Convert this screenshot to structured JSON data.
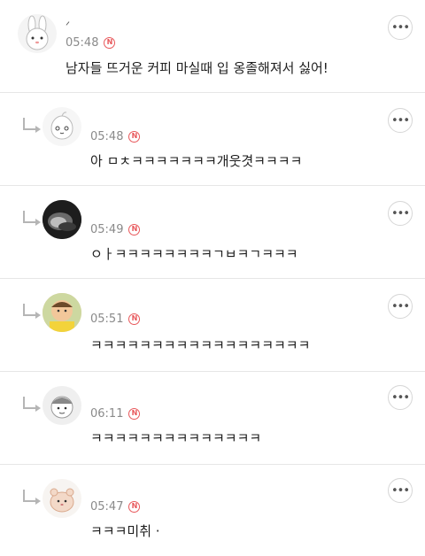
{
  "comments": [
    {
      "username": "ᐟ",
      "time": "05:48",
      "new_badge": "N",
      "text": "남자들 뜨거운 커피 마실때 입 옹졸해져서 싫어!",
      "avatar_icon": "rabbit-avatar-icon",
      "is_reply": false
    },
    {
      "time": "05:48",
      "new_badge": "N",
      "text": "아 ㅁㅊㅋㅋㅋㅋㅋㅋㅋ개웃겻ㅋㅋㅋㅋ",
      "avatar_icon": "peach-character-avatar-icon",
      "is_reply": true
    },
    {
      "time": "05:49",
      "new_badge": "N",
      "text": "ㅇㅏㅋㅋㅋㅋㅋㅋㅋㅋㄱㅂㅋㄱㅋㅋㅋ",
      "avatar_icon": "dark-photo-avatar-icon",
      "is_reply": true
    },
    {
      "time": "05:51",
      "new_badge": "N",
      "text": "ㅋㅋㅋㅋㅋㅋㅋㅋㅋㅋㅋㅋㅋㅋㅋㅋㅋㅋ",
      "avatar_icon": "child-photo-avatar-icon",
      "is_reply": true
    },
    {
      "time": "06:11",
      "new_badge": "N",
      "text": "ㅋㅋㅋㅋㅋㅋㅋㅋㅋㅋㅋㅋㅋㅋ",
      "avatar_icon": "cartoon-girl-avatar-icon",
      "is_reply": true
    },
    {
      "time": "05:47",
      "new_badge": "N",
      "text": "ㅋㅋㅋ미취 ·",
      "avatar_icon": "hamster-avatar-icon",
      "is_reply": true
    }
  ],
  "more_button_label": "•••",
  "colors": {
    "badge": "#e8585b",
    "divider": "#e6e6e6",
    "time": "#8a8a8a"
  }
}
